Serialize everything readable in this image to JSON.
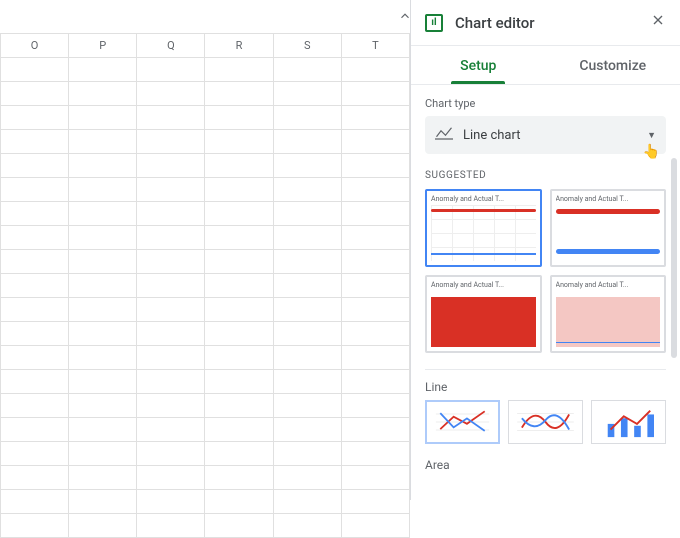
{
  "sheet": {
    "columns": [
      "O",
      "P",
      "Q",
      "R",
      "S",
      "T"
    ]
  },
  "editor": {
    "title": "Chart editor",
    "tabs": {
      "setup": "Setup",
      "customize": "Customize"
    },
    "chart_type": {
      "label": "Chart type",
      "value": "Line chart"
    },
    "suggested": {
      "label": "SUGGESTED",
      "thumb_title": "Anomaly and Actual T..."
    },
    "categories": {
      "line": "Line",
      "area": "Area"
    }
  }
}
